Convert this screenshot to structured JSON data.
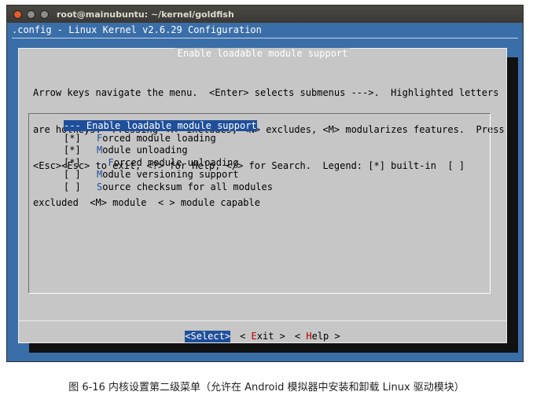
{
  "window": {
    "title": "root@mainubuntu: ~/kernel/goldfish"
  },
  "config_title": ".config - Linux Kernel v2.6.29 Configuration",
  "dialog": {
    "title": "Enable loadable module support",
    "help_lines": [
      "Arrow keys navigate the menu.  <Enter> selects submenus --->.  Highlighted letters",
      "are hotkeys.  Pressing <Y> includes, <N> excludes, <M> modularizes features.  Press",
      "<Esc><Esc> to exit, <?> for Help, </> for Search.  Legend: [*] built-in  [ ]",
      "excluded  <M> module  < > module capable"
    ],
    "items": [
      {
        "mark": "--",
        "indent": "",
        "hotkey": "",
        "label": "- Enable loadable module support",
        "selected": true
      },
      {
        "mark": "[*]",
        "indent": "",
        "hotkey": "F",
        "label": "orced module loading",
        "selected": false
      },
      {
        "mark": "[*]",
        "indent": "",
        "hotkey": "M",
        "label": "odule unloading",
        "selected": false
      },
      {
        "mark": "[*]",
        "indent": "  ",
        "hotkey": "F",
        "label": "orced module unloading",
        "selected": false
      },
      {
        "mark": "[ ]",
        "indent": "",
        "hotkey": "M",
        "label": "odule versioning support",
        "selected": false
      },
      {
        "mark": "[ ]",
        "indent": "",
        "hotkey": "S",
        "label": "ource checksum for all modules",
        "selected": false
      }
    ],
    "buttons": [
      {
        "pre": "<",
        "hotkey": "S",
        "post": "elect>",
        "active": true
      },
      {
        "pre": "< ",
        "hotkey": "E",
        "post": "xit >",
        "active": false
      },
      {
        "pre": "< ",
        "hotkey": "H",
        "post": "elp >",
        "active": false
      }
    ]
  },
  "caption": "图 6-16   内核设置第二级菜单（允许在 Android 模拟器中安装和卸载 Linux 驱动模块）"
}
